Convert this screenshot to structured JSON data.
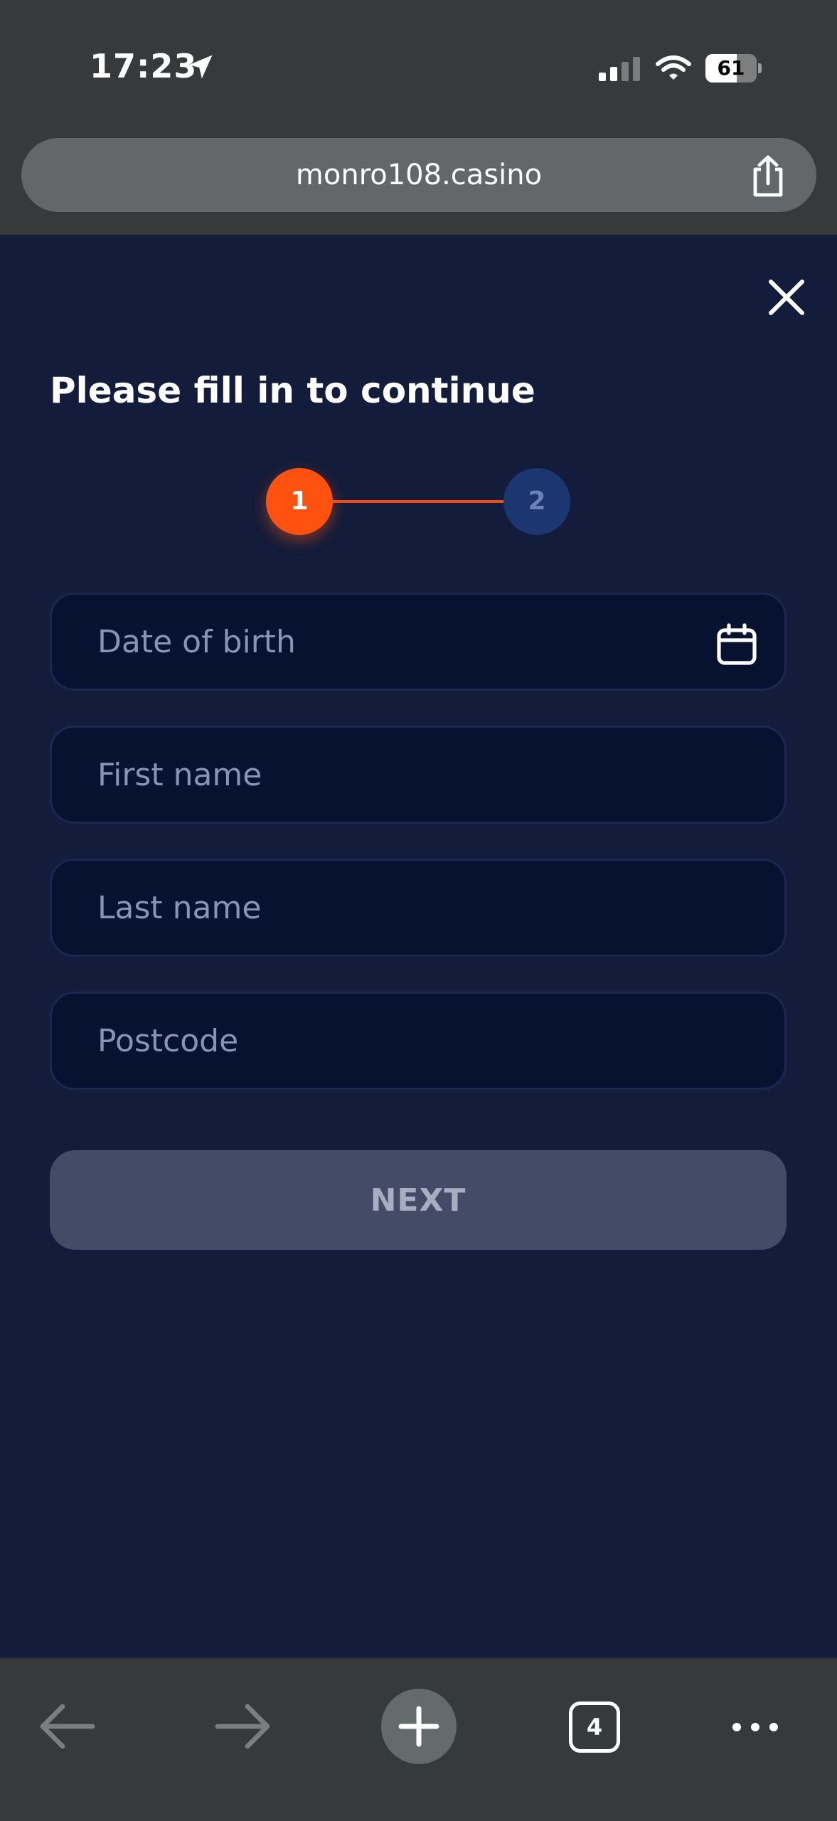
{
  "status_bar": {
    "time": "17:23",
    "battery_level": "61",
    "battery_fraction": 0.61
  },
  "browser": {
    "url": "monro108.casino",
    "tab_count": "4"
  },
  "form": {
    "title": "Please fill in to continue",
    "steps": [
      "1",
      "2"
    ],
    "active_step": 1,
    "fields": {
      "dob_placeholder": "Date of birth",
      "first_name_placeholder": "First name",
      "last_name_placeholder": "Last name",
      "postcode_placeholder": "Postcode"
    },
    "next_label": "NEXT"
  },
  "colors": {
    "background": "#131c3a",
    "accent": "#ff5210",
    "step_inactive": "#1b3670",
    "field_bg": "#071231",
    "button_disabled": "#434b67"
  },
  "icons": [
    "location-arrow-icon",
    "signal-icon",
    "wifi-icon",
    "battery-icon",
    "share-icon",
    "close-icon",
    "calendar-icon",
    "back-arrow-icon",
    "forward-arrow-icon",
    "plus-icon",
    "tabs-icon",
    "more-icon"
  ]
}
